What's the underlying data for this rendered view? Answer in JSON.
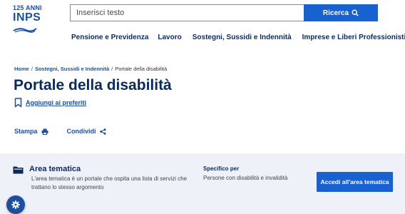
{
  "logo": {
    "anniversary": "125 ANNI",
    "brand": "INPS"
  },
  "search": {
    "placeholder": "Inserisci testo",
    "button_label": "Ricerca"
  },
  "nav": {
    "items": [
      {
        "label": "Pensione e Previdenza"
      },
      {
        "label": "Lavoro"
      },
      {
        "label": "Sostegni, Sussidi e Indennità"
      },
      {
        "label": "Imprese e Liberi Professionisti"
      }
    ]
  },
  "breadcrumb": {
    "home": "Home",
    "section": "Sostegni, Sussidi e Indennità",
    "current": "Portale della disabilità"
  },
  "page": {
    "title": "Portale della disabilità",
    "favorite_label": "Aggiungi ai preferiti"
  },
  "actions": {
    "print_label": "Stampa",
    "share_label": "Condividi"
  },
  "panel": {
    "title": "Area tematica",
    "description": "L'area tematica è un portale che ospita una lista di servizi che trattano lo stesso argomento",
    "spec_title": "Specifico per",
    "spec_value": "Persone con disabilità e invalidità",
    "cta_label": "Accedi all'area tematica"
  },
  "colors": {
    "primary": "#1761d1",
    "navy": "#0b2a5b",
    "panel_bg": "#eef2f8"
  }
}
